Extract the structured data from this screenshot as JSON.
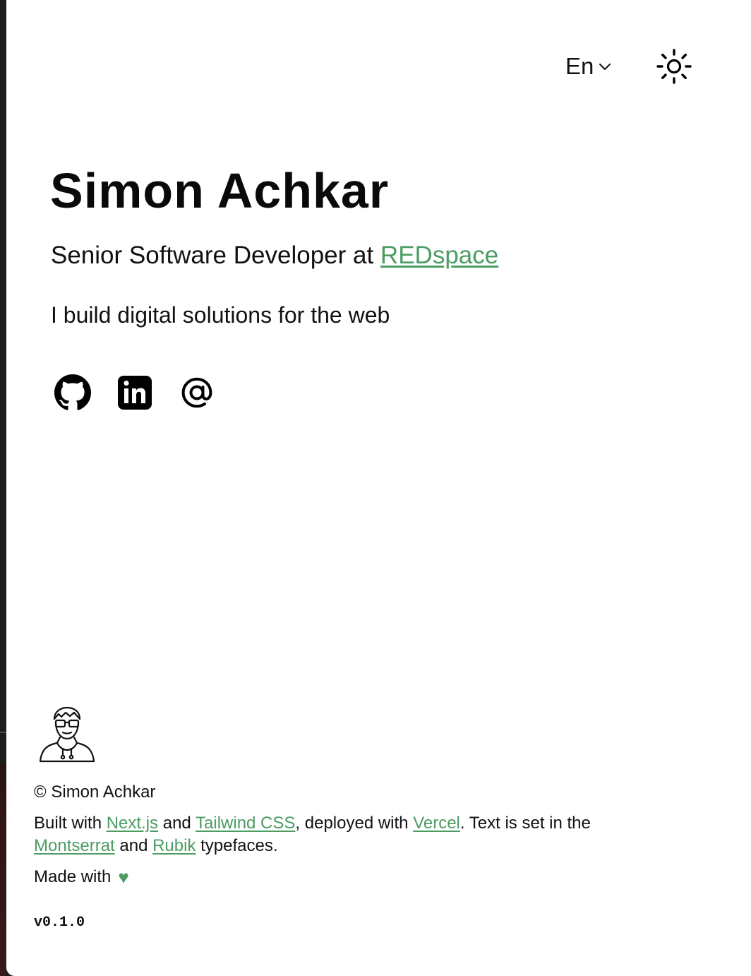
{
  "header": {
    "language": "En",
    "language_icon": "chevron-down-icon",
    "theme_icon": "sun-icon"
  },
  "hero": {
    "name": "Simon Achkar",
    "role_prefix": "Senior Software Developer at ",
    "company": "REDspace",
    "tagline": "I build digital solutions for the web"
  },
  "social": [
    {
      "name": "github",
      "icon": "github-icon"
    },
    {
      "name": "linkedin",
      "icon": "linkedin-icon"
    },
    {
      "name": "email",
      "icon": "at-sign-icon"
    }
  ],
  "footer": {
    "avatar_icon": "developer-avatar-icon",
    "copyright": "© Simon Achkar",
    "built_with": "Built with ",
    "nextjs": "Next.js",
    "and_1": " and ",
    "tailwind": "Tailwind CSS",
    "deployed_with": ", deployed with ",
    "vercel": "Vercel",
    "text_is_set": ". Text is set in the ",
    "montserrat": "Montserrat",
    "and_2": " and ",
    "rubik": "Rubik",
    "typefaces": " typefaces.",
    "made_with": "Made with",
    "heart": "♥",
    "version": "v0.1.0"
  },
  "colors": {
    "accent": "#4c9c63",
    "text": "#111111",
    "background": "#ffffff"
  }
}
